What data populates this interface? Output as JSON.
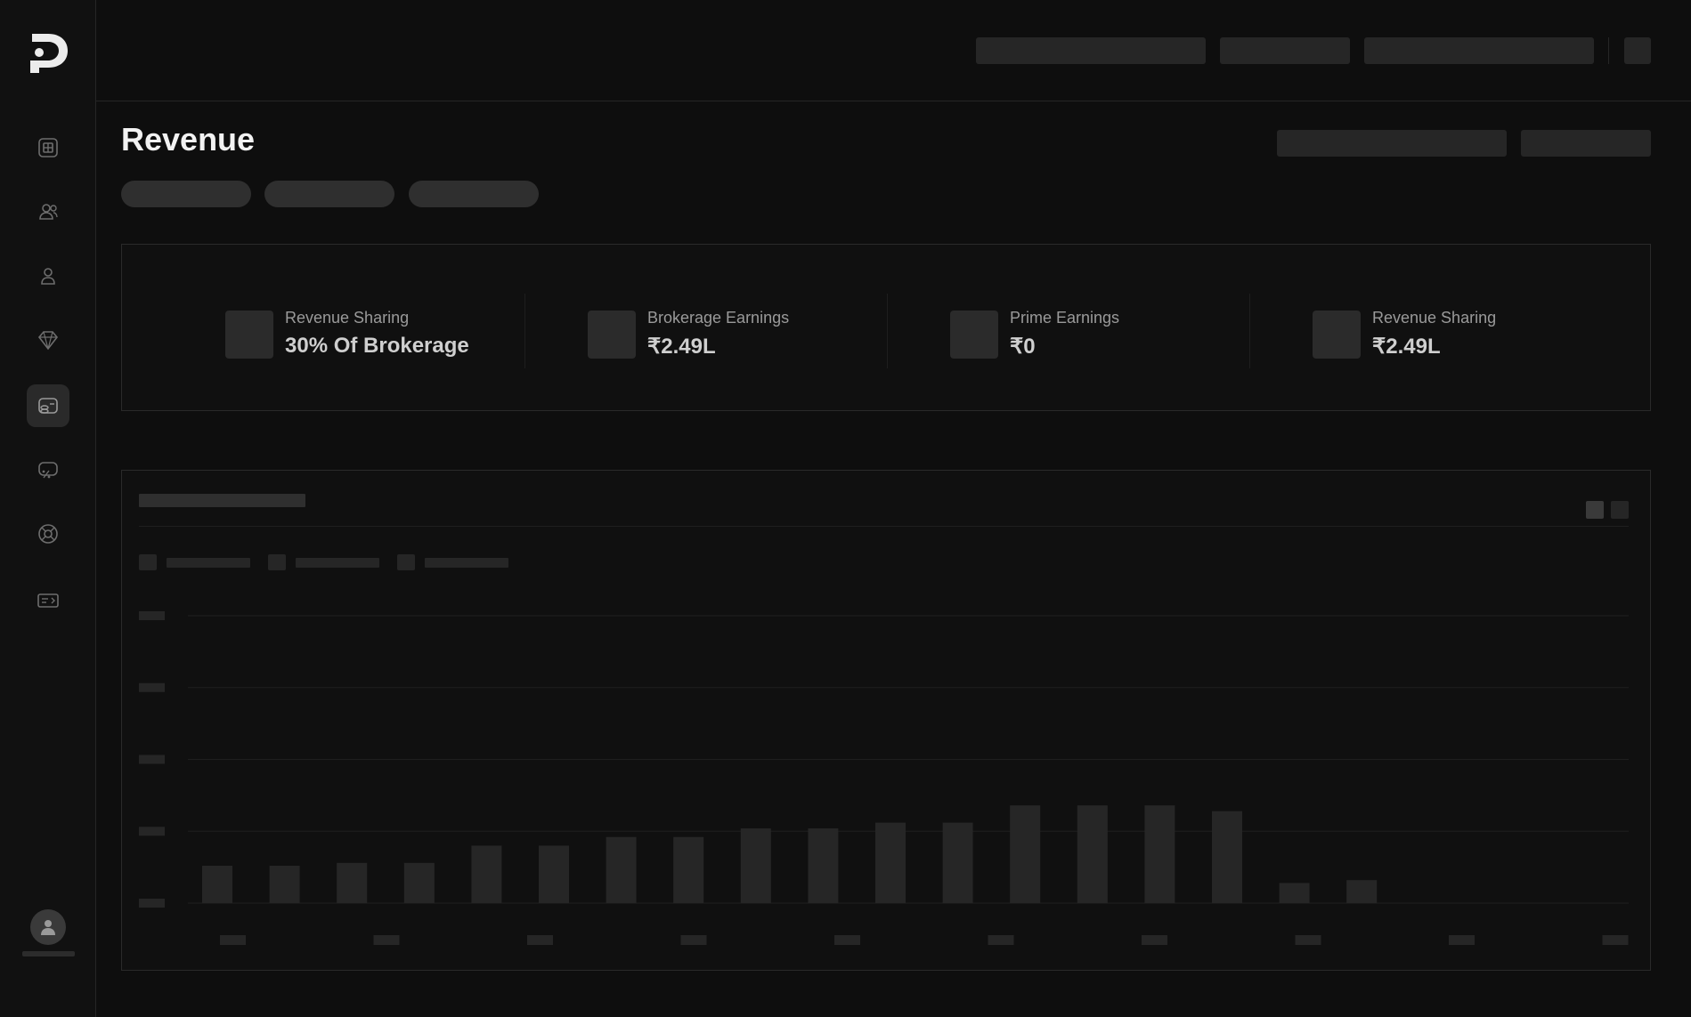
{
  "page": {
    "title": "Revenue"
  },
  "sidebar": {
    "items": [
      {
        "icon": "dashboard-icon"
      },
      {
        "icon": "users-icon"
      },
      {
        "icon": "user-icon"
      },
      {
        "icon": "diamond-icon"
      },
      {
        "icon": "revenue-icon",
        "active": true
      },
      {
        "icon": "percent-icon"
      },
      {
        "icon": "support-icon"
      },
      {
        "icon": "ticket-icon"
      }
    ]
  },
  "stats": [
    {
      "label": "Revenue Sharing",
      "value": "30% Of Brokerage"
    },
    {
      "label": "Brokerage Earnings",
      "value": "₹2.49L"
    },
    {
      "label": "Prime Earnings",
      "value": "₹0"
    },
    {
      "label": "Revenue Sharing",
      "value": "₹2.49L"
    }
  ],
  "colors": {
    "background": "#0e0e0e",
    "skeleton": "#262626",
    "bar": "#262626"
  },
  "chart_data": {
    "type": "bar",
    "state": "loading-skeleton",
    "categories": [
      "",
      "",
      "",
      "",
      "",
      "",
      "",
      "",
      "",
      "",
      "",
      "",
      "",
      "",
      "",
      "",
      "",
      ""
    ],
    "values": [
      13,
      13,
      14,
      14,
      20,
      20,
      23,
      23,
      26,
      26,
      28,
      28,
      34,
      34,
      34,
      32,
      7,
      8
    ],
    "ylim": [
      0,
      100
    ],
    "grid": true
  }
}
